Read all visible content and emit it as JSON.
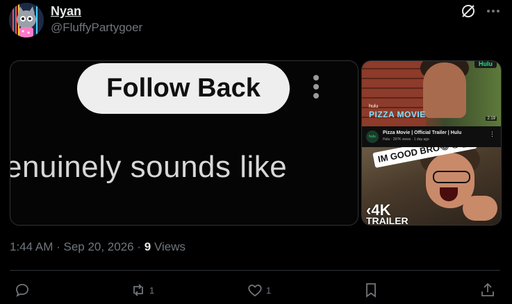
{
  "author": {
    "display_name": "Nyan",
    "handle": "@FluffyPartygoer"
  },
  "media": {
    "left": {
      "overlay_button": "Follow Back",
      "caption": "enuinely sounds like"
    },
    "right": {
      "top_badge": "Hulu",
      "brand_small": "hulu",
      "show_title": "PIZZA MOVIE",
      "duration": "2:19",
      "channel": "hulu",
      "video_title": "Pizza Movie | Official Trailer | Hulu",
      "video_meta": "Hulu · 297K views · 1 day ago",
      "sticker_text": "IM GOOD BRO😂😂🤦",
      "badge_4k": "4K",
      "badge_trailer": "TRAILER"
    }
  },
  "timestamp": {
    "time": "1:44 AM",
    "sep": " · ",
    "date": "Sep 20, 2026",
    "sep2": " · ",
    "views_count": "9",
    "views_label": " Views"
  },
  "actions": {
    "reply": {
      "icon": "reply-icon",
      "count": ""
    },
    "repost": {
      "icon": "repost-icon",
      "count": "1"
    },
    "like": {
      "icon": "heart-icon",
      "count": "1"
    },
    "bookmark": {
      "icon": "bookmark-icon",
      "count": ""
    },
    "share": {
      "icon": "share-icon",
      "count": ""
    }
  },
  "colors": {
    "background": "#000000",
    "text_primary": "#e7e9ea",
    "text_secondary": "#71767b",
    "border": "#2f3336"
  }
}
